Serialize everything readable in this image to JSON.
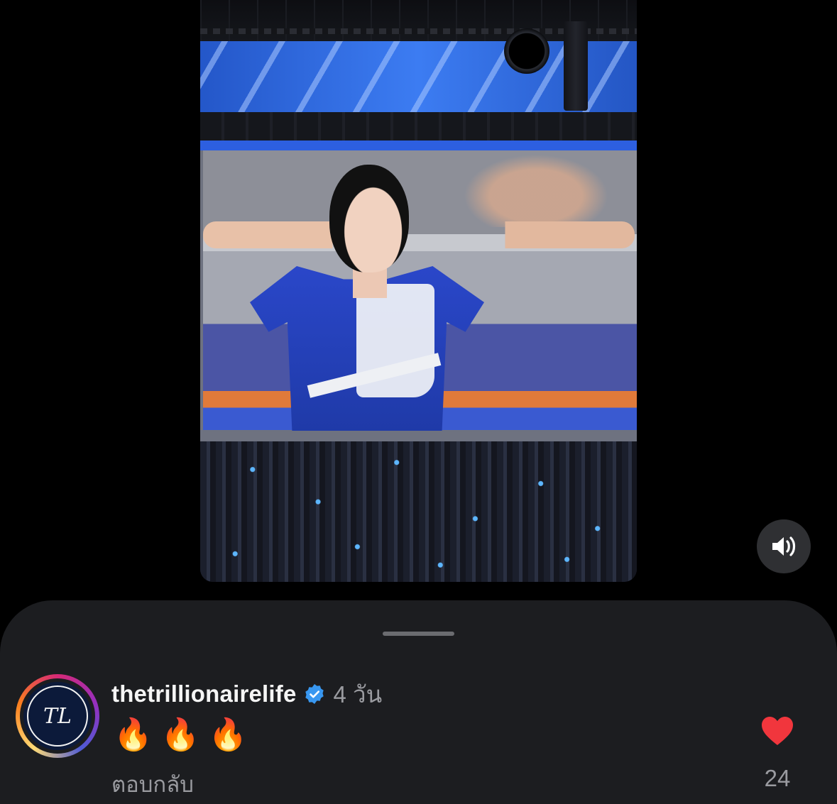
{
  "comment": {
    "username": "thetrillionairelife",
    "timestamp": "4 วัน",
    "text": "🔥🔥🔥",
    "reply_label": "ตอบกลับ",
    "like_count": "24",
    "avatar_monogram": "TL"
  },
  "controls": {
    "volume_icon": "speaker-on-icon",
    "like_icon": "heart-filled-icon"
  },
  "colors": {
    "like": "#f1363d",
    "verified": "#3897f0",
    "sheet_bg": "#1c1d20",
    "muted_text": "#9a9ba0"
  }
}
